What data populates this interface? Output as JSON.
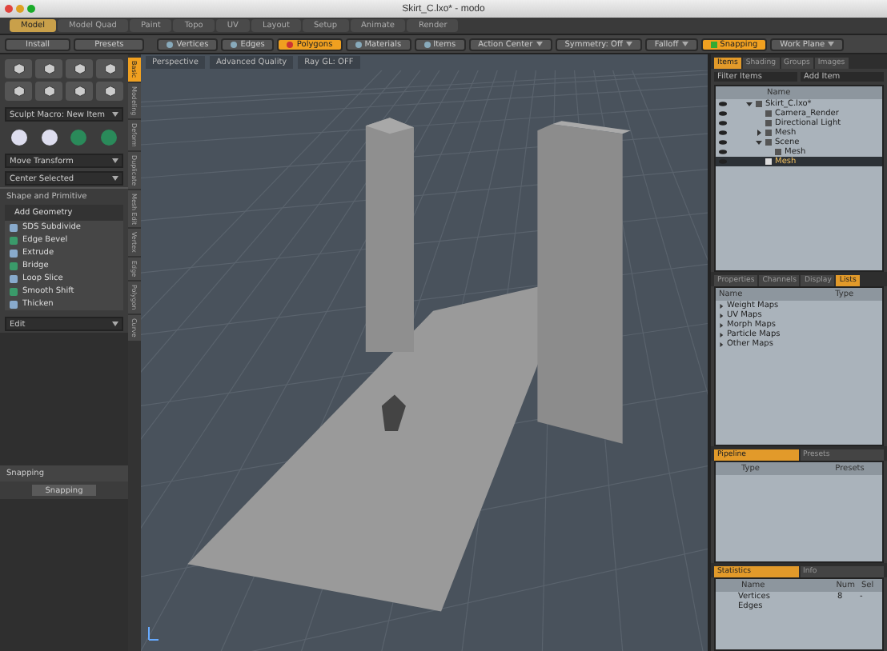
{
  "window": {
    "title": "Skirt_C.lxo* - modo"
  },
  "layout_tabs": [
    {
      "label": "Model",
      "selected": true
    },
    {
      "label": "Model Quad",
      "selected": false
    },
    {
      "label": "Paint",
      "selected": false
    },
    {
      "label": "Topo",
      "selected": false
    },
    {
      "label": "UV",
      "selected": false
    },
    {
      "label": "Layout",
      "selected": false
    },
    {
      "label": "Setup",
      "selected": false
    },
    {
      "label": "Animate",
      "selected": false
    },
    {
      "label": "Render",
      "selected": false
    }
  ],
  "toolbar": {
    "left_buttons": [
      "Install",
      "Presets"
    ],
    "modes": [
      {
        "label": "Vertices",
        "selected": false
      },
      {
        "label": "Edges",
        "selected": false
      },
      {
        "label": "Polygons",
        "selected": true
      },
      {
        "label": "Materials",
        "selected": false
      },
      {
        "label": "Items",
        "selected": false
      }
    ],
    "dropdowns": [
      "Action Center",
      "Symmetry: Off",
      "Falloff"
    ],
    "snapping": {
      "label": "Snapping",
      "on": true
    },
    "work_plane": "Work Plane"
  },
  "left_panel": {
    "macro": "Sculpt Macro: New Item",
    "transforms": [
      "Move Transform",
      "Center Selected"
    ],
    "section": "Shape and Primitive",
    "group": "Add Geometry",
    "tools": [
      "SDS Subdivide",
      "Edge Bevel",
      "Extrude",
      "Bridge",
      "Loop Slice",
      "Smooth Shift",
      "Thicken"
    ],
    "edit": "Edit",
    "side_tabs": [
      {
        "label": "Basic",
        "selected": true
      },
      {
        "label": "Modeling",
        "selected": false
      },
      {
        "label": "Deform",
        "selected": false
      },
      {
        "label": "Duplicate",
        "selected": false
      },
      {
        "label": "Mesh Edit",
        "selected": false
      },
      {
        "label": "Vertex",
        "selected": false
      },
      {
        "label": "Edge",
        "selected": false
      },
      {
        "label": "Polygon",
        "selected": false
      },
      {
        "label": "Curve",
        "selected": false
      }
    ],
    "snapping_panel": {
      "title": "Snapping",
      "button": "Snapping"
    }
  },
  "viewport": {
    "labels": [
      "Perspective",
      "Advanced Quality",
      "Ray GL: OFF"
    ]
  },
  "items_panel": {
    "tabs": [
      {
        "label": "Items",
        "selected": true
      },
      {
        "label": "Shading",
        "selected": false
      },
      {
        "label": "Groups",
        "selected": false
      },
      {
        "label": "Images",
        "selected": false
      }
    ],
    "filter": "Filter Items",
    "add_item": "Add Item",
    "column": "Name",
    "tree": [
      {
        "name": "Skirt_C.lxo*",
        "expanded": true,
        "selected": false,
        "children": [
          {
            "name": "Camera_Render",
            "selected": false
          },
          {
            "name": "Directional Light",
            "selected": false
          },
          {
            "name": "Mesh",
            "expanded": false,
            "selected": false
          },
          {
            "name": "Scene",
            "expanded": true,
            "selected": false,
            "children": [
              {
                "name": "Mesh",
                "selected": false
              }
            ]
          },
          {
            "name": "Mesh",
            "selected": true
          }
        ]
      }
    ]
  },
  "lists_panel": {
    "tabs": [
      {
        "label": "Properties",
        "selected": false
      },
      {
        "label": "Channels",
        "selected": false
      },
      {
        "label": "Display",
        "selected": false
      },
      {
        "label": "Lists",
        "selected": true
      }
    ],
    "columns": [
      "Name",
      "Type"
    ],
    "rows": [
      "Weight Maps",
      "UV Maps",
      "Morph Maps",
      "Particle Maps",
      "Other Maps"
    ]
  },
  "pipeline_panel": {
    "tabs": [
      {
        "label": "Pipeline",
        "selected": true
      },
      {
        "label": "Presets",
        "selected": false
      }
    ],
    "columns": [
      "Type",
      "Presets"
    ]
  },
  "statistics_panel": {
    "tabs": [
      {
        "label": "Statistics",
        "selected": true
      },
      {
        "label": "Info",
        "selected": false
      }
    ],
    "columns": [
      "Name",
      "Num",
      "Sel"
    ],
    "rows": [
      {
        "name": "Vertices",
        "num": "8",
        "sel": "-"
      },
      {
        "name": "Edges",
        "num": "",
        "sel": ""
      }
    ]
  }
}
